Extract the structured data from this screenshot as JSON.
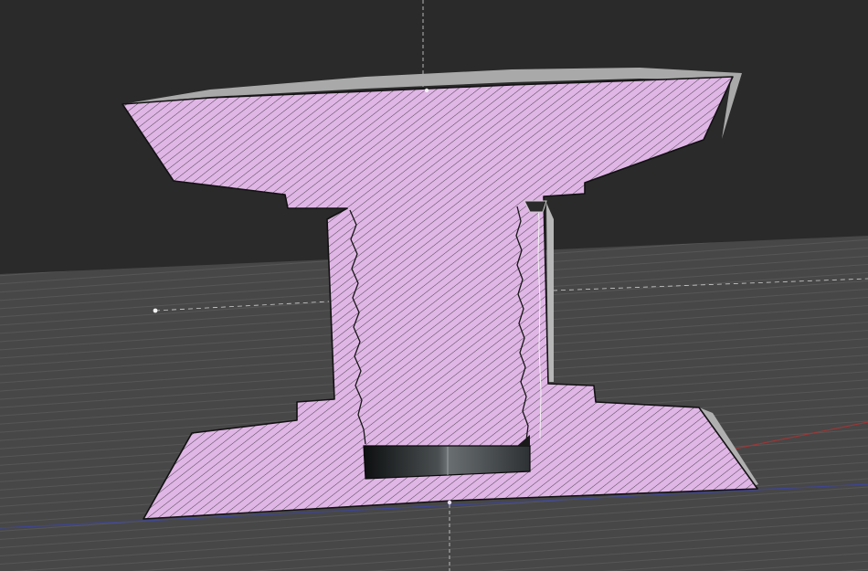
{
  "viewport": {
    "view": "section-view",
    "background_color": "#2a2a2a",
    "ground_plane_color": "#474747",
    "ground_hatch_color": "#5c5c5c"
  },
  "section": {
    "fill_color": "#e0b6e6",
    "hatch_color": "#333333",
    "outline_color": "#121212",
    "extrusion_color": "#a9a9a9"
  },
  "axes": {
    "x_axis_color": "#b03232",
    "y_axis_color": "#3d45a8",
    "vertical_guide_color": "#d9d9d9",
    "horizontal_guide_color": "#cfcfcf"
  },
  "insert": {
    "icon": "dark-metal-plate",
    "colors": [
      "#0d0f10",
      "#5f6466",
      "#2d3133"
    ]
  }
}
